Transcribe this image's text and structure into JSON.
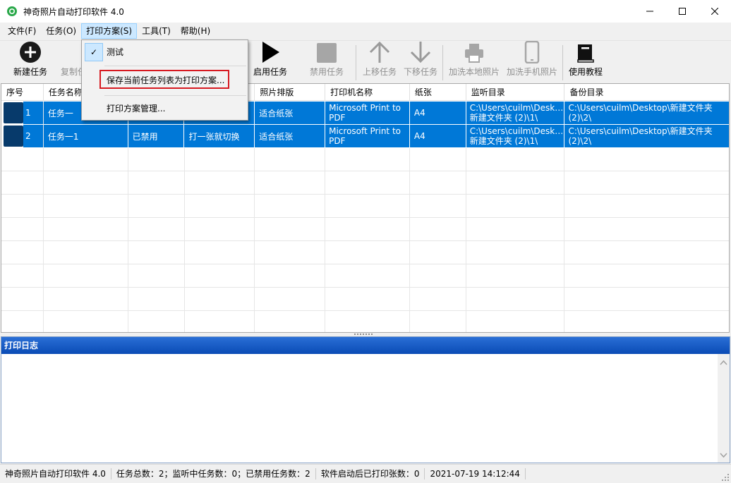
{
  "window": {
    "title": "神奇照片自动打印软件 4.0"
  },
  "menubar": [
    {
      "label": "文件(F)"
    },
    {
      "label": "任务(O)"
    },
    {
      "label": "打印方案(S)"
    },
    {
      "label": "工具(T)"
    },
    {
      "label": "帮助(H)"
    }
  ],
  "toolbar": {
    "new_task": "新建任务",
    "copy_task": "复制任",
    "enable_task": "启用任务",
    "disable_task": "禁用任务",
    "move_up": "上移任务",
    "move_down": "下移任务",
    "print_local": "加洗本地照片",
    "print_phone": "加洗手机照片",
    "tutorial": "使用教程"
  },
  "dropdown": {
    "item_test": "测试",
    "item_save": "保存当前任务列表为打印方案...",
    "item_manage": "打印方案管理...",
    "check_glyph": "✓"
  },
  "grid": {
    "columns": [
      "序号",
      "任务名称",
      "",
      "",
      "照片排版",
      "打印机名称",
      "纸张",
      "监听目录",
      "备份目录"
    ],
    "rows": [
      {
        "no": "1",
        "name": "任务一",
        "status": "",
        "mode": "",
        "layout": "适合纸张",
        "printer_l1": "Microsoft Print to",
        "printer_l2": "PDF",
        "paper": "A4",
        "watch_l1": "C:\\Users\\cuilm\\Deskt...",
        "watch_l2": "新建文件夹 (2)\\1\\",
        "backup_l1": "C:\\Users\\cuilm\\Desktop\\新建文件夹",
        "backup_l2": "(2)\\2\\"
      },
      {
        "no": "2",
        "name": "任务一1",
        "status": "已禁用",
        "mode": "打一张就切换",
        "layout": "适合纸张",
        "printer_l1": "Microsoft Print to",
        "printer_l2": "PDF",
        "paper": "A4",
        "watch_l1": "C:\\Users\\cuilm\\Deskt...",
        "watch_l2": "新建文件夹 (2)\\1\\",
        "backup_l1": "C:\\Users\\cuilm\\Desktop\\新建文件夹",
        "backup_l2": "(2)\\2\\"
      }
    ]
  },
  "log": {
    "title": "打印日志"
  },
  "status": {
    "app": "神奇照片自动打印软件 4.0",
    "counts": "任务总数：2；监听中任务数：0；已禁用任务数：2",
    "printed": "软件启动后已打印张数：0",
    "datetime": "2021-07-19 14:12:44"
  },
  "colors": {
    "selection": "#0078d7",
    "row_tag": "#073a6b",
    "log_header": "#0a4bb5",
    "highlight_box": "#d71920"
  }
}
